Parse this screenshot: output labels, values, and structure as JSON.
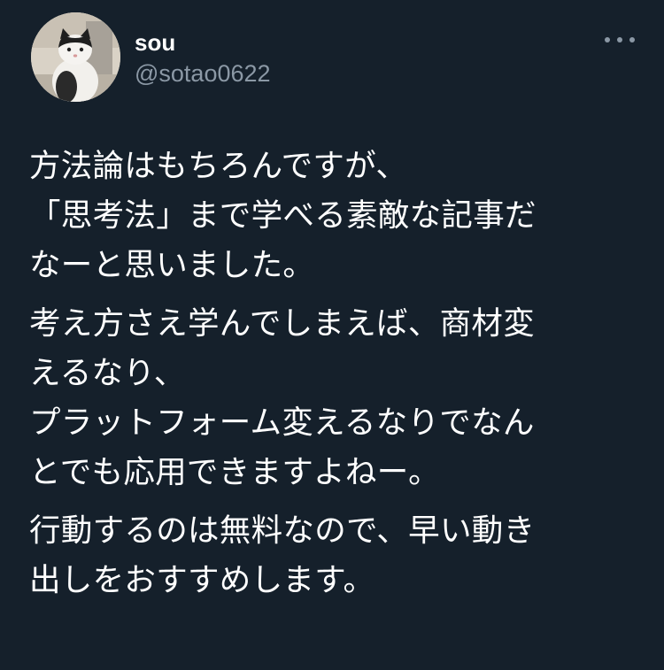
{
  "tweet": {
    "author": {
      "display_name": "sou",
      "handle": "@sotao0622"
    },
    "more_icon": "ellipsis-horizontal-icon",
    "body": {
      "paragraphs": [
        {
          "lines": [
            "方法論はもちろんですが、",
            "「思考法」まで学べる素敵な記事だ",
            "なーと思いました。"
          ]
        },
        {
          "lines": [
            "考え方さえ学んでしまえば、商材変",
            "えるなり、",
            "プラットフォーム変えるなりでなん",
            "とでも応用できますよねー。"
          ]
        },
        {
          "lines": [
            "行動するのは無料なので、早い動き",
            "出しをおすすめします。"
          ]
        }
      ]
    }
  },
  "colors": {
    "background": "#15202b",
    "text_primary": "#ffffff",
    "text_secondary": "#8b98a5"
  }
}
